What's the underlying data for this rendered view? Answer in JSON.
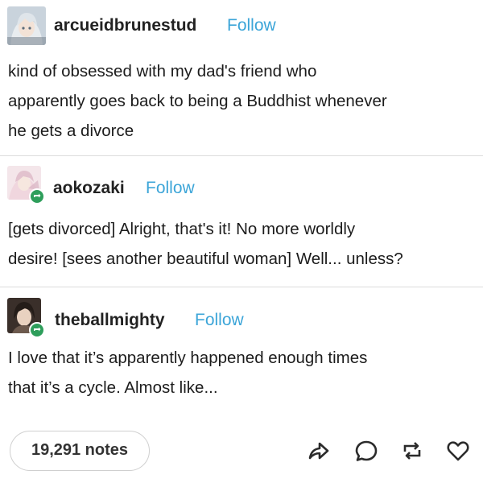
{
  "posts": [
    {
      "username": "arcueidbrunestud",
      "follow_label": "Follow",
      "text": "kind of obsessed with my dad's friend who\napparently goes back to being a Buddhist whenever\nhe gets a divorce",
      "avatar_icon": "anime-character-avatar"
    },
    {
      "username": "aokozaki",
      "follow_label": "Follow",
      "text": "[gets divorced] Alright, that's it! No more worldly\ndesire! [sees another beautiful woman] Well... unless?",
      "avatar_icon": "anime-character-avatar",
      "badge_icon": "reblog-badge-icon"
    },
    {
      "username": "theballmighty",
      "follow_label": "Follow",
      "text": "I love that it’s apparently happened enough times\nthat it’s a cycle. Almost like...",
      "avatar_icon": "anime-character-avatar",
      "badge_icon": "reblog-badge-icon"
    }
  ],
  "footer": {
    "notes_label": "19,291 notes",
    "actions": [
      "share-icon",
      "reply-icon",
      "reblog-icon",
      "like-icon"
    ]
  },
  "colors": {
    "follow": "#3ca5d8",
    "badge": "#2e9e5b",
    "divider": "#dcdcdc",
    "text": "#1c1c1c"
  }
}
